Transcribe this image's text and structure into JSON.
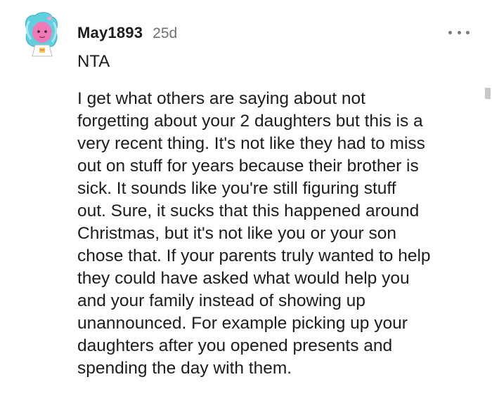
{
  "comment": {
    "username": "May1893",
    "timestamp": "25d",
    "more_icon": "more-horizontal-icon",
    "short_reply": "NTA",
    "body_lines": [
      "I get what others are saying about not",
      "forgetting about your 2 daughters but this is a",
      "very recent thing. It's not like they had to miss",
      "out on stuff for years because their brother is",
      "sick. It sounds like you're still figuring stuff",
      "out. Sure, it sucks that this happened around",
      "Christmas, but it's not like you or your son",
      "chose that. If your parents truly wanted to help",
      "they could have asked what would help you",
      "and your family instead of showing up",
      "unannounced. For example picking up your",
      "daughters after you opened presents and",
      "spending the day with them."
    ]
  },
  "colors": {
    "text": "#1c1c1c",
    "meta": "#6f6f6f",
    "avatar_teal": "#5fd0e0",
    "avatar_pink": "#f07ab8"
  }
}
